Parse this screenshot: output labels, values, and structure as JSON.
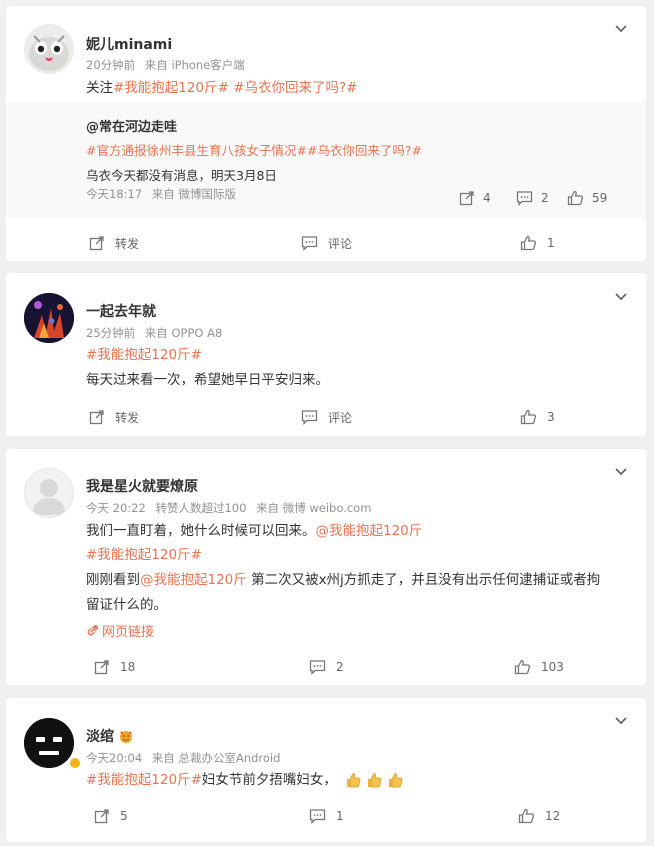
{
  "posts": [
    {
      "user": "妮儿minami",
      "time": "20分钟前",
      "source": "来自 iPhone客户端",
      "text_prefix": "关注",
      "tag1": "#我能抱起120斤#",
      "tag2": "#乌衣你回来了吗?#",
      "repost": {
        "author": "@常在河边走哇",
        "tags": "#官方通报徐州丰县生育八孩女子情况##乌衣你回来了吗?#",
        "text": "乌衣今天都没有消息，明天3月8日",
        "time": "今天18:17",
        "source": "来自 微博国际版",
        "reposts": "4",
        "comments": "2",
        "likes": "59"
      },
      "repost_label": "转发",
      "comment_label": "评论",
      "likes": "1"
    },
    {
      "user": "一起去年就",
      "time": "25分钟前",
      "source": "来自 OPPO A8",
      "tag": "#我能抱起120斤#",
      "text": "每天过来看一次，希望她早日平安归来。",
      "repost_label": "转发",
      "comment_label": "评论",
      "likes": "3"
    },
    {
      "user": "我是星火就要燎原",
      "time": "今天 20:22",
      "likes_meta": "转赞人数超过100",
      "source": "来自 微博 weibo.com",
      "line1_text": "我们一直盯着，她什么时候可以回来。",
      "line1_mention": "@我能抱起120斤",
      "line2_tag": "#我能抱起120斤#",
      "line3_pre": "刚刚看到",
      "line3_mention": "@我能抱起120斤",
      "line3_post": " 第二次又被x州j方抓走了，并且没有出示任何逮捕证或者拘",
      "line4": "留证什么的。",
      "link": "网页链接",
      "reposts": "18",
      "comments": "2",
      "likes": "103"
    },
    {
      "user": "淡绾",
      "time": "今天20:04",
      "source": "来自 总裁办公室Android",
      "tag": "#我能抱起120斤#",
      "text": "妇女节前夕捂嘴妇女，",
      "reposts": "5",
      "comments": "1",
      "likes": "12"
    }
  ],
  "colors": {
    "accent": "#eb7350",
    "meta": "#939393",
    "text": "#333333",
    "background": "#f0f0f0"
  },
  "icons": [
    "chevron-down-icon",
    "repost-icon",
    "comment-icon",
    "like-icon",
    "link-icon",
    "verified-badge-icon"
  ]
}
